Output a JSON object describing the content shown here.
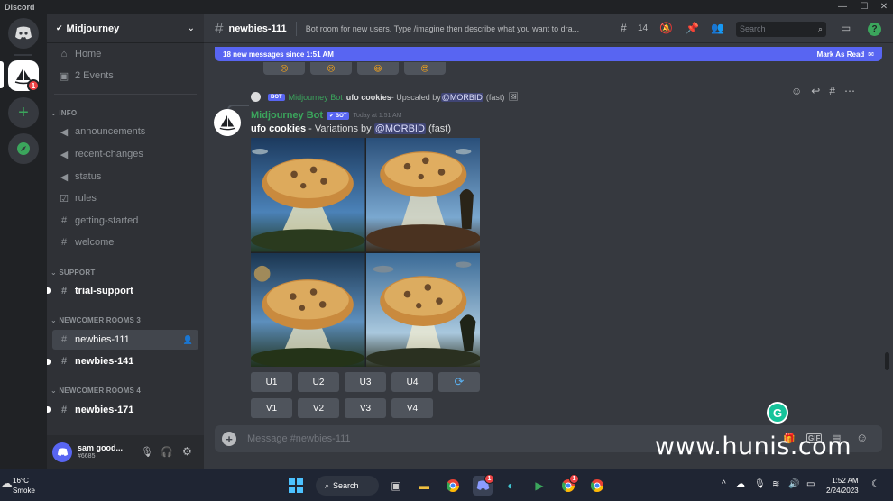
{
  "window": {
    "app_title": "Discord"
  },
  "servers": {
    "home_badge": "1"
  },
  "guild": {
    "name": "Midjourney"
  },
  "channels": {
    "home": "Home",
    "events": "2 Events",
    "cat_info": "INFO",
    "announcements": "announcements",
    "recent_changes": "recent-changes",
    "status": "status",
    "rules": "rules",
    "getting_started": "getting-started",
    "welcome": "welcome",
    "cat_support": "SUPPORT",
    "trial_support": "trial-support",
    "cat_newcomer3": "NEWCOMER ROOMS 3",
    "newbies_111": "newbies-111",
    "newbies_141": "newbies-141",
    "cat_newcomer4": "NEWCOMER ROOMS 4",
    "newbies_171": "newbies-171"
  },
  "user": {
    "name": "sam good...",
    "tag": "#6685"
  },
  "topbar": {
    "channel": "newbies-111",
    "topic": "Bot room for new users. Type /imagine then describe what you want to dra...",
    "threads_count": "14",
    "search_placeholder": "Search"
  },
  "new_messages": {
    "text": "18 new messages since 1:51 AM",
    "mark_read": "Mark As Read"
  },
  "reply": {
    "bot_badge": "BOT",
    "author": "Midjourney Bot",
    "prompt": "ufo cookies",
    "text": " - Upscaled by ",
    "mention": "@MORBID",
    "speed": "(fast)"
  },
  "message": {
    "author": "Midjourney Bot",
    "bot_badge": "BOT",
    "timestamp": "Today at 1:51 AM",
    "prompt": "ufo cookies",
    "text": " - Variations by ",
    "mention": "@MORBID",
    "speed": "(fast)"
  },
  "buttons": {
    "upscale": [
      "U1",
      "U2",
      "U3",
      "U4"
    ],
    "variation": [
      "V1",
      "V2",
      "V3",
      "V4"
    ]
  },
  "composer": {
    "placeholder": "Message #newbies-111",
    "gif": "GIF"
  },
  "watermark": "www.hunis.com",
  "taskbar": {
    "temp": "16°C",
    "weather": "Smoke",
    "search": "Search",
    "discord_badge": "1",
    "chrome_badge": "1",
    "time": "1:52 AM",
    "date": "2/24/2023"
  },
  "colors": {
    "blurple": "#5865f2",
    "bot_green": "#3ba55c",
    "bg_main": "#36393f",
    "bg_sidebar": "#2f3136",
    "bg_servers": "#202225",
    "taskbar": "#1f2533"
  }
}
